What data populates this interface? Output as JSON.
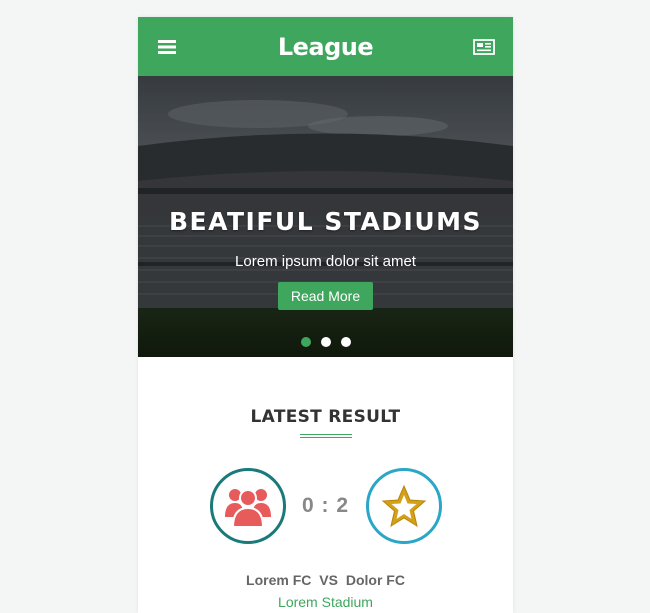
{
  "app": {
    "title": "League",
    "menu_icon": "hamburger-menu-icon",
    "news_icon": "newspaper-icon",
    "accent_color": "#3fa75d"
  },
  "hero": {
    "title": "BEATIFUL STADIUMS",
    "subtitle": "Lorem ipsum dolor sit amet",
    "button_label": "Read More",
    "slides_count": 3,
    "active_slide": 1
  },
  "latest_result": {
    "heading": "LATEST RESULT",
    "home_team": {
      "name": "Lorem FC",
      "icon": "users-group-icon",
      "color": "#e85b5b"
    },
    "away_team": {
      "name": "Dolor FC",
      "icon": "star-icon",
      "color": "#d4a017"
    },
    "home_score": "0",
    "separator": ":",
    "away_score": "2",
    "vs": "VS",
    "venue": "Lorem Stadium"
  }
}
